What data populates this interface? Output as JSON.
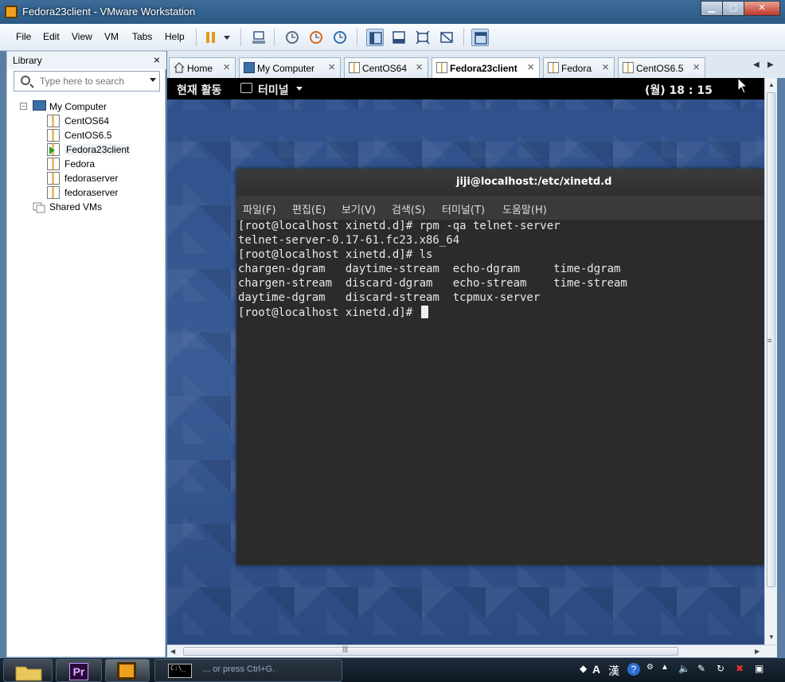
{
  "window": {
    "title": "Fedora23client - VMware Workstation"
  },
  "menu": {
    "file": "File",
    "edit": "Edit",
    "view": "View",
    "vm": "VM",
    "tabs": "Tabs",
    "help": "Help"
  },
  "library": {
    "title": "Library",
    "close": "×",
    "search_placeholder": "Type here to search",
    "tree": {
      "root": "My Computer",
      "expander": "−",
      "vms": [
        {
          "label": "CentOS64"
        },
        {
          "label": "CentOS6.5"
        },
        {
          "label": "Fedora23client"
        },
        {
          "label": "Fedora"
        },
        {
          "label": "fedoraserver"
        },
        {
          "label": "fedoraserver"
        }
      ],
      "shared": "Shared VMs"
    }
  },
  "tabs": [
    {
      "label": "Home",
      "close": "×"
    },
    {
      "label": "My Computer",
      "close": "×"
    },
    {
      "label": "CentOS64",
      "close": "×"
    },
    {
      "label": "Fedora23client",
      "close": "×"
    },
    {
      "label": "Fedora",
      "close": "×"
    },
    {
      "label": "CentOS6.5",
      "close": "×"
    }
  ],
  "tab_nav": {
    "prev": "◀",
    "next": "▶"
  },
  "guest": {
    "topbar": {
      "activities": "현재 활동",
      "terminal_menu": "터미널",
      "clock": "(월) 18 : 15"
    },
    "terminal": {
      "title": "jiji@localhost:/etc/xinetd.d",
      "menus": [
        "파일(F)",
        "편집(E)",
        "보기(V)",
        "검색(S)",
        "터미널(T)",
        "도움말(H)"
      ],
      "lines": [
        "[root@localhost xinetd.d]# rpm -qa telnet-server",
        "telnet-server-0.17-61.fc23.x86_64",
        "[root@localhost xinetd.d]# ls",
        "chargen-dgram   daytime-stream  echo-dgram     time-dgram",
        "chargen-stream  discard-dgram   echo-stream    time-stream",
        "daytime-dgram   discard-stream  tcpmux-server",
        "[root@localhost xinetd.d]# "
      ]
    }
  },
  "scroll": {
    "up": "▲",
    "down": "▼",
    "left": "◀",
    "right": "▶",
    "vgrip": "≡",
    "hgrip": "|||"
  },
  "taskbar": {
    "premiere_label": "Pr",
    "cmd_label": "C:\\_",
    "status_text": "... or press Ctrl+G.",
    "tray_a": "A",
    "tray_han": "漢",
    "tray_help": "?"
  }
}
